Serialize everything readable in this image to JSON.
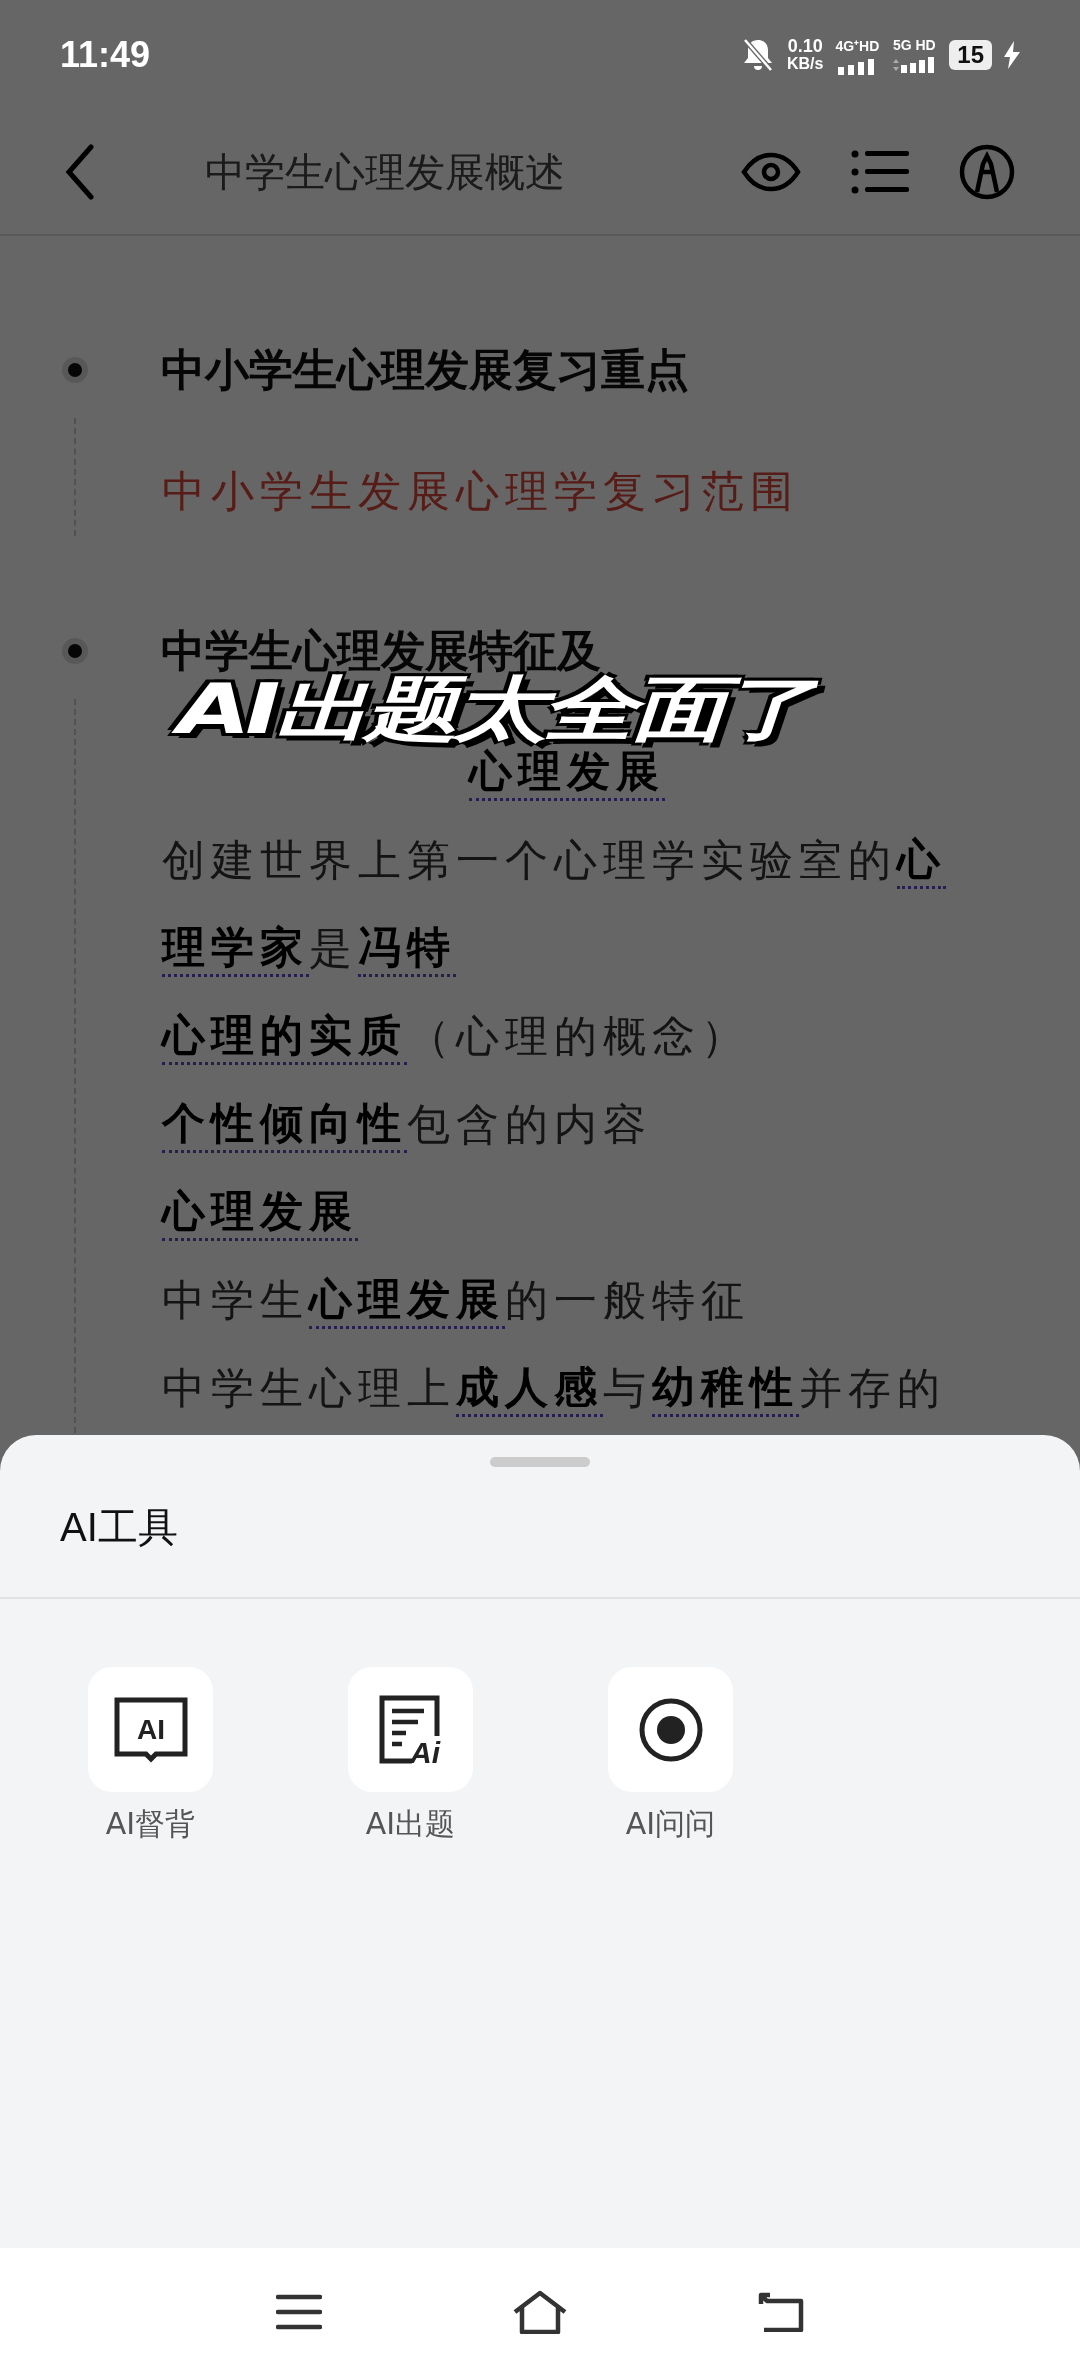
{
  "status_bar": {
    "time": "11:49",
    "speed": "0.10",
    "speed_unit": "KB/s",
    "sim_1": "4G⁺HD",
    "sim_2": "5G HD",
    "battery": "15"
  },
  "header": {
    "title": "中学生心理发展概述"
  },
  "outline": [
    {
      "heading": "中小学生心理发展复习重点",
      "children": [
        {
          "segments": [
            {
              "kind": "red",
              "text": "中小学生发展心理学复习范围"
            }
          ]
        }
      ]
    },
    {
      "heading": "中学生心理发展特征及",
      "children": [
        {
          "segments": [
            {
              "kind": "covered-term",
              "text": "心理发展"
            }
          ]
        },
        {
          "segments": [
            {
              "kind": "plain",
              "text": "创建世界上第一个心理学实验室的"
            },
            {
              "kind": "term",
              "text": "心"
            }
          ]
        },
        {
          "segments": [
            {
              "kind": "term",
              "text": "理学家"
            },
            {
              "kind": "plain",
              "text": "是"
            },
            {
              "kind": "term",
              "text": "冯特"
            }
          ]
        },
        {
          "segments": [
            {
              "kind": "term",
              "text": "心理的实质"
            },
            {
              "kind": "plain",
              "text": "（心理的概念）"
            }
          ]
        },
        {
          "segments": [
            {
              "kind": "term",
              "text": "个性倾向性"
            },
            {
              "kind": "plain",
              "text": "包含的内容"
            }
          ]
        },
        {
          "segments": [
            {
              "kind": "term",
              "text": "心理发展"
            }
          ]
        },
        {
          "segments": [
            {
              "kind": "plain",
              "text": "中学生"
            },
            {
              "kind": "term",
              "text": "心理发展"
            },
            {
              "kind": "plain",
              "text": "的一般特征"
            }
          ]
        },
        {
          "segments": [
            {
              "kind": "plain",
              "text": "中学生心理上"
            },
            {
              "kind": "term",
              "text": "成人感"
            },
            {
              "kind": "plain",
              "text": "与"
            },
            {
              "kind": "term",
              "text": "幼稚性"
            },
            {
              "kind": "plain",
              "text": "并存的"
            }
          ]
        }
      ]
    }
  ],
  "caption": "AI出题太全面了",
  "sheet": {
    "title": "AI工具",
    "tools": [
      {
        "kind": "book",
        "icon_text": "AI",
        "label": "AI督背"
      },
      {
        "kind": "doc",
        "icon_text": "Ai",
        "label": "AI出题"
      },
      {
        "kind": "record",
        "label": "AI问问"
      }
    ]
  }
}
